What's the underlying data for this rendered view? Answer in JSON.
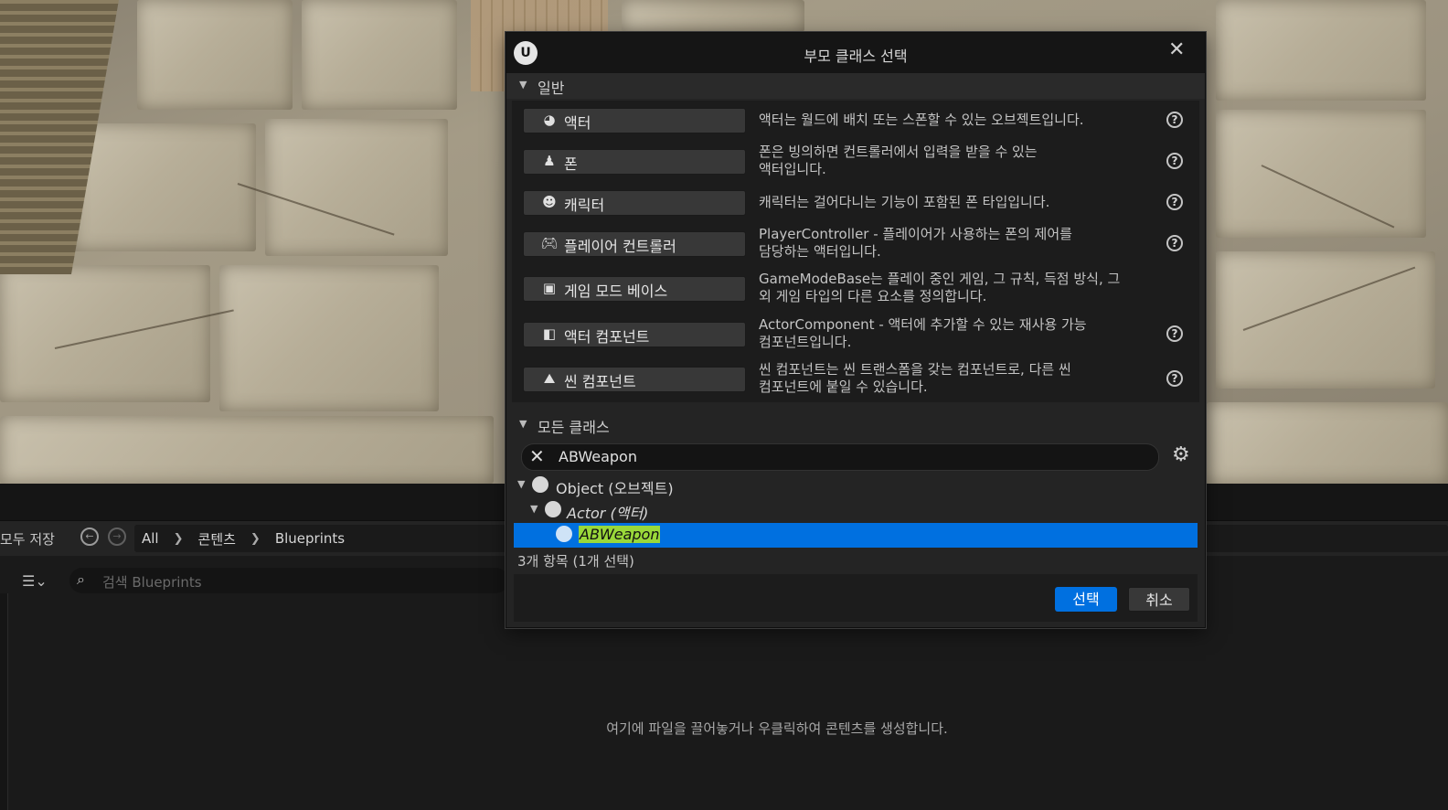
{
  "content_browser": {
    "save_all": "모두 저장",
    "breadcrumbs": [
      "All",
      "콘텐츠",
      "Blueprints"
    ],
    "search_placeholder": "검색 Blueprints",
    "empty_message": "여기에 파일을 끌어놓거나 우클릭하여 콘텐츠를 생성합니다."
  },
  "dialog": {
    "title": "부모 클래스 선택",
    "common_section": "일반",
    "common_classes": [
      {
        "label": "액터",
        "icon": "actor-icon",
        "description": "액터는 월드에 배치 또는 스폰할 수 있는 오브젝트입니다.",
        "description2": ""
      },
      {
        "label": "폰",
        "icon": "pawn-icon",
        "description": "폰은 빙의하면 컨트롤러에서 입력을 받을 수 있는",
        "description2": "액터입니다."
      },
      {
        "label": "캐릭터",
        "icon": "character-icon",
        "description": "캐릭터는 걸어다니는 기능이 포함된 폰 타입입니다.",
        "description2": ""
      },
      {
        "label": "플레이어 컨트롤러",
        "icon": "gamepad-icon",
        "description": "PlayerController - 플레이어가 사용하는 폰의 제어를",
        "description2": "담당하는 액터입니다."
      },
      {
        "label": "게임 모드 베이스",
        "icon": "game-mode-icon",
        "description": "GameModeBase는 플레이 중인 게임, 그 규칙, 득점 방식, 그",
        "description2": "외 게임 타입의 다른 요소를 정의합니다."
      },
      {
        "label": "액터 컴포넌트",
        "icon": "actor-component-icon",
        "description": "ActorComponent - 액터에 추가할 수 있는 재사용 가능",
        "description2": "컴포넌트입니다."
      },
      {
        "label": "씬 컴포넌트",
        "icon": "scene-component-icon",
        "description": "씬 컴포넌트는 씬 트랜스폼을 갖는 컴포넌트로, 다른 씬",
        "description2": "컴포넌트에 붙일 수 있습니다."
      }
    ],
    "all_classes_section": "모든 클래스",
    "search_value": "ABWeapon",
    "tree": [
      {
        "label": "Object",
        "suffix": "(오브젝트)"
      },
      {
        "label": "Actor",
        "suffix": "(액터)"
      },
      {
        "label": "ABWeapon",
        "suffix": ""
      }
    ],
    "item_count": "3개 항목 (1개 선택)",
    "select_button": "선택",
    "cancel_button": "취소",
    "selection_color": "#0070e0"
  }
}
